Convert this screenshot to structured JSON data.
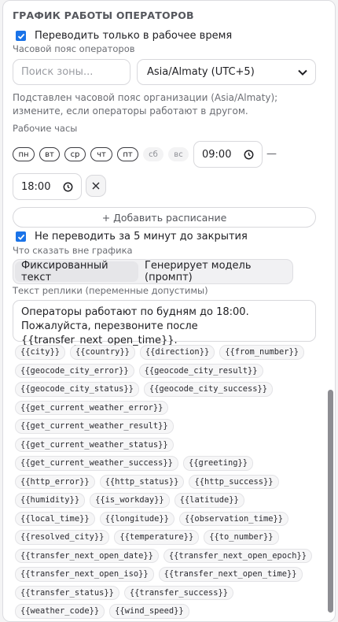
{
  "section_title": "ГРАФИК РАБОТЫ ОПЕРАТОРОВ",
  "only_work_hours_label": "Переводить только в рабочее время",
  "timezone_label": "Часовой пояс операторов",
  "timezone_search_placeholder": "Поиск зоны...",
  "timezone_selected": "Asia/Almaty (UTC+5)",
  "timezone_hint": "Подставлен часовой пояс организации (Asia/Almaty); измените, если операторы работают в другом.",
  "work_hours_label": "Рабочие часы",
  "days": [
    {
      "label": "пн",
      "active": true
    },
    {
      "label": "вт",
      "active": true
    },
    {
      "label": "ср",
      "active": true
    },
    {
      "label": "чт",
      "active": true
    },
    {
      "label": "пт",
      "active": true
    },
    {
      "label": "сб",
      "active": false
    },
    {
      "label": "вс",
      "active": false
    }
  ],
  "time_from": "09:00",
  "time_separator": "—",
  "time_to": "18:00",
  "add_schedule_label": "+ Добавить расписание",
  "no_transfer_before_close_label": "Не переводить за 5 минут до закрытия",
  "outside_schedule_label": "Что сказать вне графика",
  "mode_options": [
    "Фиксированный текст",
    "Генерирует модель (промпт)"
  ],
  "mode_selected": "Фиксированный текст",
  "reply_text_label": "Текст реплики (переменные допустимы)",
  "reply_text": "Операторы работают по будням до 18:00. Пожалуйста, перезвоните после {{transfer_next_open_time}}.",
  "variables": [
    "{{city}}",
    "{{country}}",
    "{{direction}}",
    "{{from_number}}",
    "{{geocode_city_error}}",
    "{{geocode_city_result}}",
    "{{geocode_city_status}}",
    "{{geocode_city_success}}",
    "{{get_current_weather_error}}",
    "{{get_current_weather_result}}",
    "{{get_current_weather_status}}",
    "{{get_current_weather_success}}",
    "{{greeting}}",
    "{{http_error}}",
    "{{http_status}}",
    "{{http_success}}",
    "{{humidity}}",
    "{{is_workday}}",
    "{{latitude}}",
    "{{local_time}}",
    "{{longitude}}",
    "{{observation_time}}",
    "{{resolved_city}}",
    "{{temperature}}",
    "{{to_number}}",
    "{{transfer_next_open_date}}",
    "{{transfer_next_open_epoch}}",
    "{{transfer_next_open_iso}}",
    "{{transfer_next_open_time}}",
    "{{transfer_status}}",
    "{{transfer_success}}",
    "{{weather_code}}",
    "{{wind_speed}}"
  ],
  "colors": {
    "accent": "#1a73e8",
    "panel_bg": "#ffffff",
    "chip_bg": "#f6f6f7"
  }
}
